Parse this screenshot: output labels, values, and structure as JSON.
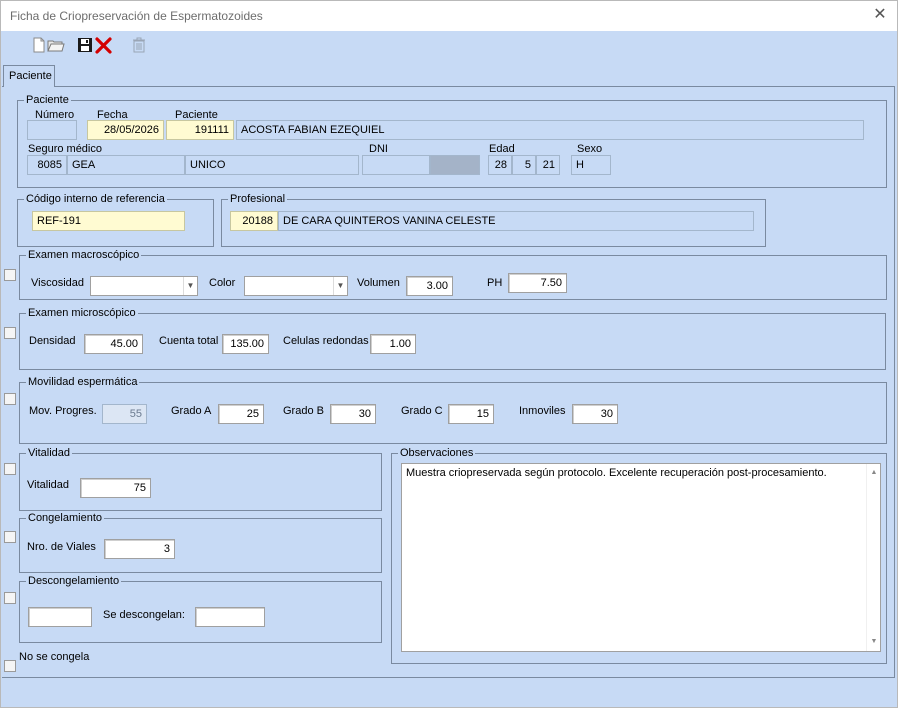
{
  "window": {
    "title": "Ficha de Criopreservación de Espermatozoides"
  },
  "toolbar": {
    "new": "new-document-icon",
    "open": "open-folder-icon",
    "save": "save-disk-icon",
    "cancel": "cancel-x-icon",
    "delete": "trash-icon"
  },
  "tab": {
    "label": "Paciente"
  },
  "paciente": {
    "group": "Paciente",
    "numero_label": "Número",
    "numero": "",
    "fecha_label": "Fecha",
    "fecha": "28/05/2026",
    "paciente_label": "Paciente",
    "paciente_id": "191111",
    "paciente_nombre": "ACOSTA FABIAN EZEQUIEL",
    "seguro_label": "Seguro médico",
    "seguro_codigo": "8085",
    "seguro_nombre": "GEA",
    "seguro_plan": "UNICO",
    "dni_label": "DNI",
    "dni": "",
    "edad_label": "Edad",
    "edad_a": "28",
    "edad_m": "5",
    "edad_d": "21",
    "sexo_label": "Sexo",
    "sexo": "H"
  },
  "codigo": {
    "group": "Código interno de referencia",
    "value": "REF-191"
  },
  "profesional": {
    "group": "Profesional",
    "id": "20188",
    "nombre": "DE CARA QUINTEROS VANINA CELESTE"
  },
  "macro": {
    "group": "Examen macroscópico",
    "viscosidad_label": "Viscosidad",
    "viscosidad": "",
    "color_label": "Color",
    "color": "",
    "volumen_label": "Volumen",
    "volumen": "3.00",
    "ph_label": "PH",
    "ph": "7.50"
  },
  "micro": {
    "group": "Examen microscópico",
    "densidad_label": "Densidad",
    "densidad": "45.00",
    "cuenta_label": "Cuenta total",
    "cuenta": "135.00",
    "celulas_label": "Celulas redondas",
    "celulas": "1.00"
  },
  "movilidad": {
    "group": "Movilidad espermática",
    "mov_label": "Mov. Progres.",
    "mov": "55",
    "a_label": "Grado A",
    "a": "25",
    "b_label": "Grado B",
    "b": "30",
    "c_label": "Grado C",
    "c": "15",
    "inm_label": "Inmoviles",
    "inm": "30"
  },
  "vitalidad": {
    "group": "Vitalidad",
    "label": "Vitalidad",
    "value": "75"
  },
  "congelamiento": {
    "group": "Congelamiento",
    "label": "Nro. de Viales",
    "value": "3"
  },
  "descongelamiento": {
    "group": "Descongelamiento",
    "field1": "",
    "label": "Se descongelan:",
    "value": ""
  },
  "no_congela": {
    "label": "No se congela"
  },
  "observaciones": {
    "group": "Observaciones",
    "text": "Muestra criopreservada según protocolo. Excelente recuperación post-procesamiento."
  },
  "colors": {
    "client_bg": "#c7daf5",
    "required_bg": "#fffbd2",
    "cancel_red": "#d40000"
  }
}
